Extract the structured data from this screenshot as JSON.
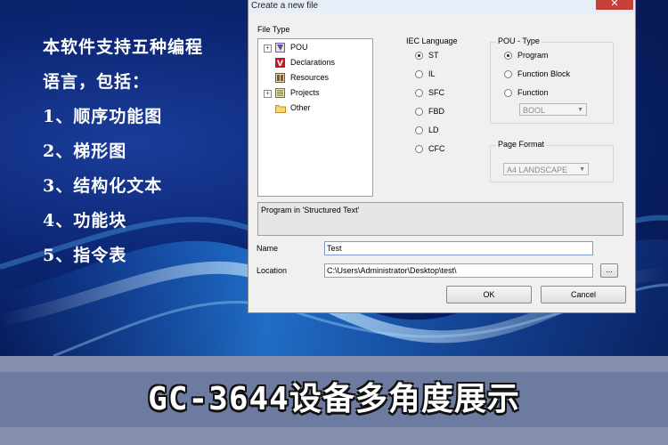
{
  "intro": {
    "lines": [
      "本软件支持五种编程",
      "语言，包括：",
      "1、顺序功能图",
      "2、梯形图",
      "3、结构化文本",
      "4、功能块",
      "5、指令表"
    ]
  },
  "dialog": {
    "title": "Create a new file",
    "close_glyph": "✕",
    "file_type_label": "File Type",
    "tree_items": [
      {
        "label": "POU",
        "icon": "pou-icon",
        "expandable": true
      },
      {
        "label": "Declarations",
        "icon": "declarations-icon",
        "expandable": false
      },
      {
        "label": "Resources",
        "icon": "resources-icon",
        "expandable": false
      },
      {
        "label": "Projects",
        "icon": "projects-icon",
        "expandable": true
      },
      {
        "label": "Other",
        "icon": "folder-icon",
        "expandable": false
      }
    ],
    "iec_label": "IEC Language",
    "iec_options": [
      {
        "label": "ST",
        "selected": true
      },
      {
        "label": "IL",
        "selected": false
      },
      {
        "label": "SFC",
        "selected": false
      },
      {
        "label": "FBD",
        "selected": false
      },
      {
        "label": "LD",
        "selected": false
      },
      {
        "label": "CFC",
        "selected": false
      }
    ],
    "pou_type_label": "POU - Type",
    "pou_types": [
      {
        "label": "Program",
        "selected": true
      },
      {
        "label": "Function Block",
        "selected": false
      },
      {
        "label": "Function",
        "selected": false
      }
    ],
    "return_type_value": "BOOL",
    "page_format_label": "Page Format",
    "page_format_value": "A4 LANDSCAPE",
    "description": "Program in 'Structured Text'",
    "name_label": "Name",
    "name_value": "Test",
    "location_label": "Location",
    "location_value": "C:\\Users\\Administrator\\Desktop\\test\\",
    "browse_label": "...",
    "ok_label": "OK",
    "cancel_label": "Cancel"
  },
  "banner": {
    "text": "GC-3644设备多角度展示"
  },
  "colors": {
    "background": "#0b2572",
    "banner": "#6e7ba0",
    "footer": "#8590ad",
    "close_button": "#c7403a"
  }
}
